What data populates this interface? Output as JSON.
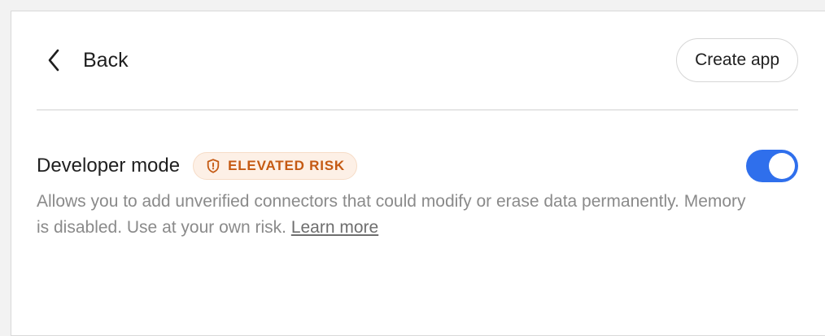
{
  "header": {
    "back_label": "Back",
    "create_app_label": "Create app"
  },
  "developer_mode": {
    "title": "Developer mode",
    "badge_label": "ELEVATED RISK",
    "badge_icon": "shield-alert-icon",
    "enabled": true,
    "description": "Allows you to add unverified connectors that could modify or erase data permanently. Memory is disabled. Use at your own risk.",
    "learn_more": "Learn more"
  },
  "colors": {
    "toggle_on": "#2f6fec",
    "badge_text": "#c55a13",
    "badge_bg": "#fdf0e6"
  }
}
